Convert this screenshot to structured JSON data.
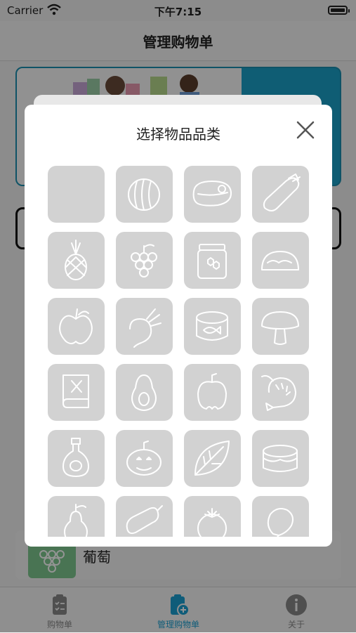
{
  "status_bar": {
    "carrier": "Carrier",
    "time": "下午7:15"
  },
  "nav": {
    "title": "管理购物单"
  },
  "background_item": {
    "name": "葡萄"
  },
  "tabs": [
    {
      "label": "购物单",
      "icon": "clipboard-icon"
    },
    {
      "label": "管理购物单",
      "icon": "clipboard-add-icon"
    },
    {
      "label": "关于",
      "icon": "info-icon"
    }
  ],
  "modal": {
    "title": "选择物品品类",
    "categories": [
      "blank-icon",
      "watermelon-icon",
      "steak-icon",
      "eggplant-icon",
      "pineapple-icon",
      "grapes-icon",
      "honey-jar-icon",
      "taco-icon",
      "apple-icon",
      "beet-icon",
      "canned-fish-icon",
      "mushroom-icon",
      "cookbook-icon",
      "avocado-icon",
      "bell-pepper-icon",
      "shrimp-icon",
      "oil-bottle-icon",
      "pumpkin-icon",
      "leaf-icon",
      "cake-icon",
      "pear-icon",
      "sausage-icon",
      "tomato-icon",
      "drumstick-icon"
    ]
  },
  "colors": {
    "accent": "#1a9fd0",
    "tile": "#d2d2d2",
    "banner": "#1aa0c8"
  }
}
